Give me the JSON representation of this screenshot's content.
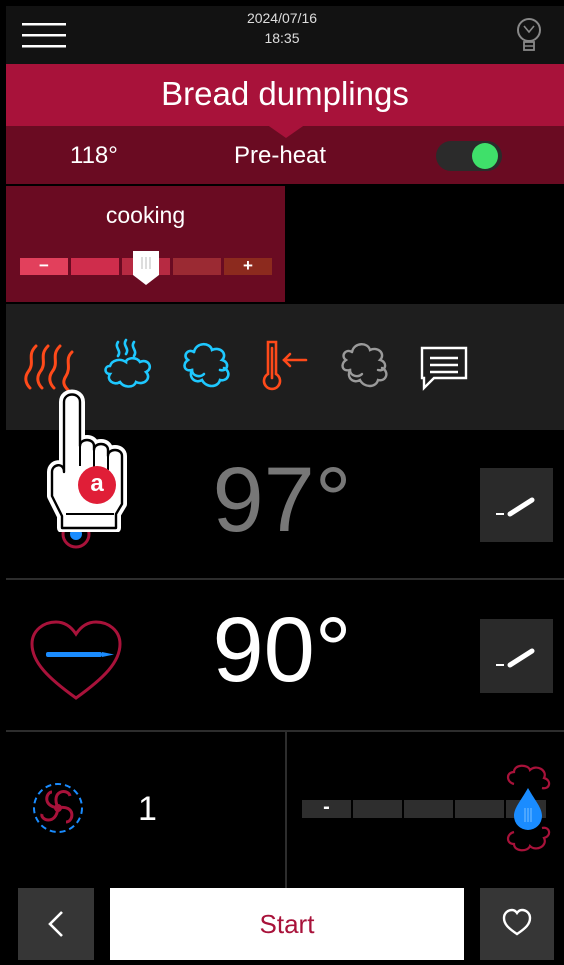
{
  "header": {
    "date": "2024/07/16",
    "time": "18:35"
  },
  "program": {
    "title": "Bread dumplings"
  },
  "preheat": {
    "temperature": "118°",
    "label": "Pre-heat",
    "enabled": true
  },
  "cooking": {
    "label": "cooking",
    "minus": "−",
    "plus": "+",
    "level": 0.5
  },
  "modes": [
    "dry-heat-icon",
    "steam-icon",
    "combi-steam-icon",
    "core-temperature-icon",
    "smoke-icon",
    "notes-icon"
  ],
  "callout": {
    "label": "a"
  },
  "cabinet": {
    "temperature": "97°"
  },
  "core": {
    "temperature": "90°"
  },
  "fan": {
    "value": "1"
  },
  "humidity": {
    "minus": "-",
    "level": 1.0
  },
  "footer": {
    "start_label": "Start"
  },
  "colors": {
    "brand": "#a8123a",
    "dark_brand": "#6a0b22",
    "accent_cyan": "#1ec8ff",
    "accent_orange": "#ff4a1a",
    "toggle_on": "#3fe06a",
    "water_blue": "#1a8cff"
  }
}
